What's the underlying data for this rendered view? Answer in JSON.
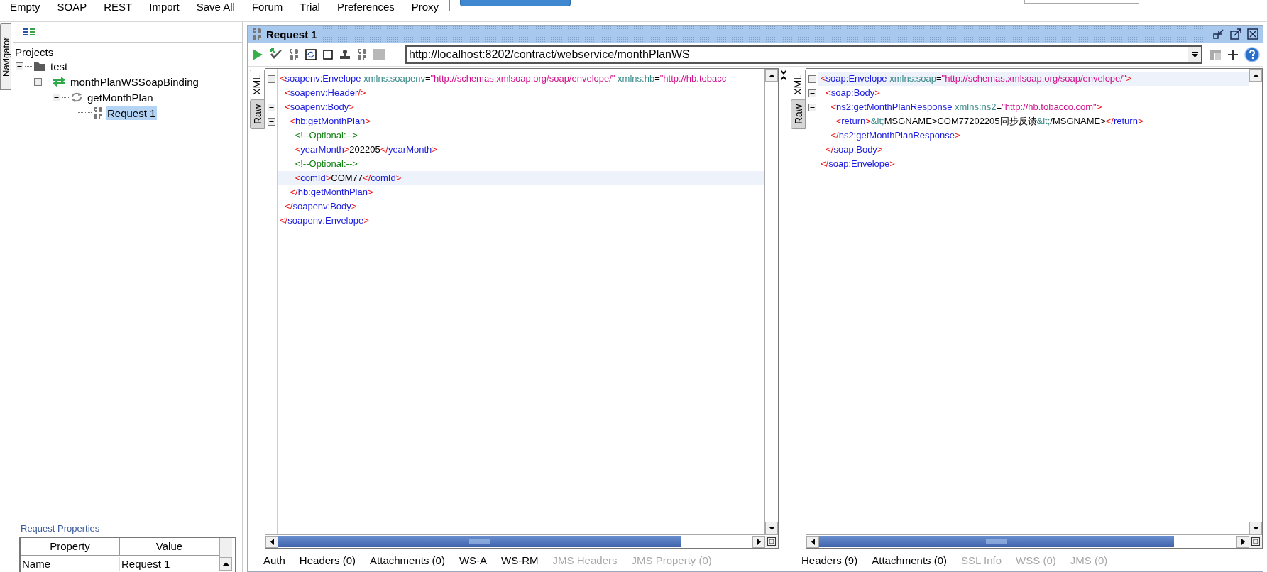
{
  "menu_bar": {
    "items": [
      "Empty",
      "SOAP",
      "REST",
      "Import",
      "Save All",
      "Forum",
      "Trial",
      "Preferences",
      "Proxy"
    ]
  },
  "navigator": {
    "tab_label": "Navigator",
    "title": "Projects",
    "tree": [
      {
        "label": "test",
        "kind": "project",
        "expanded": true,
        "selected": false,
        "children": [
          {
            "label": "monthPlanWSSoapBinding",
            "kind": "interface",
            "expanded": true,
            "selected": false,
            "children": [
              {
                "label": "getMonthPlan",
                "kind": "operation",
                "expanded": true,
                "selected": false,
                "children": [
                  {
                    "label": "Request 1",
                    "kind": "request",
                    "selected": true
                  }
                ]
              }
            ]
          }
        ]
      }
    ],
    "properties": {
      "title": "Request Properties",
      "columns": [
        "Property",
        "Value"
      ],
      "rows": [
        [
          "Name",
          "Request 1"
        ]
      ]
    }
  },
  "request_window": {
    "title": "Request 1",
    "endpoint": "http://localhost:8202/contract/webservice/monthPlanWS",
    "request": {
      "tabs": [
        {
          "label": "XML",
          "selected": true
        },
        {
          "label": "Raw",
          "selected": false
        }
      ],
      "lines": [
        {
          "fold": true,
          "highlighted": false,
          "tokens": [
            {
              "kind": "bracket",
              "text": "<"
            },
            {
              "kind": "tag",
              "text": "soapenv:Envelope"
            },
            {
              "kind": "attr",
              "text": " xmlns:soapenv"
            },
            {
              "kind": "text",
              "text": "="
            },
            {
              "kind": "value",
              "text": "\"http://schemas.xmlsoap.org/soap/envelope/\""
            },
            {
              "kind": "attr",
              "text": " xmlns:hb"
            },
            {
              "kind": "text",
              "text": "="
            },
            {
              "kind": "value",
              "text": "\"http://hb.tobacc"
            }
          ]
        },
        {
          "fold": false,
          "highlighted": false,
          "tokens": [
            {
              "kind": "bracket",
              "text": "  <"
            },
            {
              "kind": "tag",
              "text": "soapenv:Header"
            },
            {
              "kind": "bracket",
              "text": "/>"
            }
          ]
        },
        {
          "fold": true,
          "highlighted": false,
          "tokens": [
            {
              "kind": "bracket",
              "text": "  <"
            },
            {
              "kind": "tag",
              "text": "soapenv:Body"
            },
            {
              "kind": "bracket",
              "text": ">"
            }
          ]
        },
        {
          "fold": true,
          "highlighted": false,
          "tokens": [
            {
              "kind": "bracket",
              "text": "    <"
            },
            {
              "kind": "tag",
              "text": "hb:getMonthPlan"
            },
            {
              "kind": "bracket",
              "text": ">"
            }
          ]
        },
        {
          "fold": false,
          "highlighted": false,
          "tokens": [
            {
              "kind": "comment",
              "text": "      <!--Optional:-->"
            }
          ]
        },
        {
          "fold": false,
          "highlighted": false,
          "tokens": [
            {
              "kind": "bracket",
              "text": "      <"
            },
            {
              "kind": "tag",
              "text": "yearMonth"
            },
            {
              "kind": "bracket",
              "text": ">"
            },
            {
              "kind": "text",
              "text": "202205"
            },
            {
              "kind": "bracket",
              "text": "</"
            },
            {
              "kind": "tag",
              "text": "yearMonth"
            },
            {
              "kind": "bracket",
              "text": ">"
            }
          ]
        },
        {
          "fold": false,
          "highlighted": false,
          "tokens": [
            {
              "kind": "comment",
              "text": "      <!--Optional:-->"
            }
          ]
        },
        {
          "fold": false,
          "highlighted": true,
          "tokens": [
            {
              "kind": "bracket",
              "text": "      <"
            },
            {
              "kind": "tag",
              "text": "comId"
            },
            {
              "kind": "bracket",
              "text": ">"
            },
            {
              "kind": "text",
              "text": "COM77"
            },
            {
              "kind": "bracket",
              "text": "</"
            },
            {
              "kind": "tag",
              "text": "comId"
            },
            {
              "kind": "bracket",
              "text": ">"
            }
          ]
        },
        {
          "fold": false,
          "highlighted": false,
          "tokens": [
            {
              "kind": "bracket",
              "text": "    </"
            },
            {
              "kind": "tag",
              "text": "hb:getMonthPlan"
            },
            {
              "kind": "bracket",
              "text": ">"
            }
          ]
        },
        {
          "fold": false,
          "highlighted": false,
          "tokens": [
            {
              "kind": "bracket",
              "text": "  </"
            },
            {
              "kind": "tag",
              "text": "soapenv:Body"
            },
            {
              "kind": "bracket",
              "text": ">"
            }
          ]
        },
        {
          "fold": false,
          "highlighted": false,
          "tokens": [
            {
              "kind": "bracket",
              "text": "</"
            },
            {
              "kind": "tag",
              "text": "soapenv:Envelope"
            },
            {
              "kind": "bracket",
              "text": ">"
            }
          ]
        }
      ],
      "bottom_tabs": [
        {
          "label": "Auth",
          "disabled": false
        },
        {
          "label": "Headers (0)",
          "disabled": false
        },
        {
          "label": "Attachments (0)",
          "disabled": false
        },
        {
          "label": "WS-A",
          "disabled": false
        },
        {
          "label": "WS-RM",
          "disabled": false
        },
        {
          "label": "JMS Headers",
          "disabled": true
        },
        {
          "label": "JMS Property (0)",
          "disabled": true
        }
      ]
    },
    "response": {
      "tabs": [
        {
          "label": "XML",
          "selected": true
        },
        {
          "label": "Raw",
          "selected": false
        }
      ],
      "lines": [
        {
          "fold": true,
          "highlighted": true,
          "tokens": [
            {
              "kind": "bracket",
              "text": "<"
            },
            {
              "kind": "tag",
              "text": "soap:Envelope"
            },
            {
              "kind": "attr",
              "text": " xmlns:soap"
            },
            {
              "kind": "text",
              "text": "="
            },
            {
              "kind": "value",
              "text": "\"http://schemas.xmlsoap.org/soap/envelope/\""
            },
            {
              "kind": "bracket",
              "text": ">"
            }
          ]
        },
        {
          "fold": true,
          "highlighted": false,
          "tokens": [
            {
              "kind": "bracket",
              "text": "  <"
            },
            {
              "kind": "tag",
              "text": "soap:Body"
            },
            {
              "kind": "bracket",
              "text": ">"
            }
          ]
        },
        {
          "fold": true,
          "highlighted": false,
          "tokens": [
            {
              "kind": "bracket",
              "text": "    <"
            },
            {
              "kind": "tag",
              "text": "ns2:getMonthPlanResponse"
            },
            {
              "kind": "attr",
              "text": " xmlns:ns2"
            },
            {
              "kind": "text",
              "text": "="
            },
            {
              "kind": "value",
              "text": "\"http://hb.tobacco.com\""
            },
            {
              "kind": "bracket",
              "text": ">"
            }
          ]
        },
        {
          "fold": false,
          "highlighted": false,
          "tokens": [
            {
              "kind": "bracket",
              "text": "      <"
            },
            {
              "kind": "tag",
              "text": "return"
            },
            {
              "kind": "bracket",
              "text": ">"
            },
            {
              "kind": "attr",
              "text": "&lt;"
            },
            {
              "kind": "text",
              "text": "MSGNAME>COM77202205同步反馈"
            },
            {
              "kind": "attr",
              "text": "&lt;"
            },
            {
              "kind": "text",
              "text": "/MSGNAME>"
            },
            {
              "kind": "bracket",
              "text": "</"
            },
            {
              "kind": "tag",
              "text": "return"
            },
            {
              "kind": "bracket",
              "text": ">"
            }
          ]
        },
        {
          "fold": false,
          "highlighted": false,
          "tokens": [
            {
              "kind": "bracket",
              "text": "    </"
            },
            {
              "kind": "tag",
              "text": "ns2:getMonthPlanResponse"
            },
            {
              "kind": "bracket",
              "text": ">"
            }
          ]
        },
        {
          "fold": false,
          "highlighted": false,
          "tokens": [
            {
              "kind": "bracket",
              "text": "  </"
            },
            {
              "kind": "tag",
              "text": "soap:Body"
            },
            {
              "kind": "bracket",
              "text": ">"
            }
          ]
        },
        {
          "fold": false,
          "highlighted": false,
          "tokens": [
            {
              "kind": "bracket",
              "text": "</"
            },
            {
              "kind": "tag",
              "text": "soap:Envelope"
            },
            {
              "kind": "bracket",
              "text": ">"
            }
          ]
        }
      ],
      "bottom_tabs": [
        {
          "label": "Headers (9)",
          "disabled": false
        },
        {
          "label": "Attachments (0)",
          "disabled": false
        },
        {
          "label": "SSL Info",
          "disabled": true
        },
        {
          "label": "WSS (0)",
          "disabled": true
        },
        {
          "label": "JMS (0)",
          "disabled": true
        }
      ]
    }
  }
}
